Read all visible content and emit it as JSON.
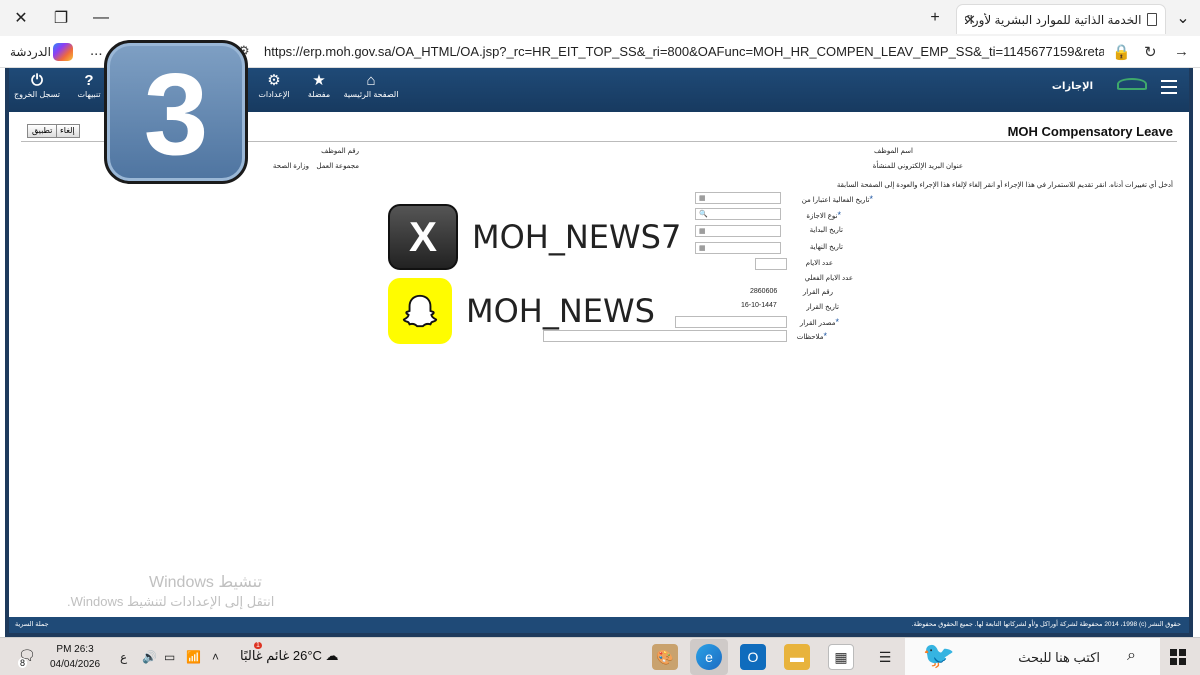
{
  "browser": {
    "tab_title": "الخدمة الذاتية للموارد البشرية لأوراكل",
    "url": "https://erp.moh.gov.sa/OA_HTML/OA.jsp?_rc=HR_EIT_TOP_SS&_ri=800&OAFunc=MOH_HR_COMPEN_LEAV_EMP_SS&_ti=1145677159&retainAM=Y&add...",
    "chat_label": "الدردشة",
    "more_label": "...",
    "new_tab_label": "+"
  },
  "app_header": {
    "section_title": "الإجازات",
    "nav": [
      {
        "label": "تسجل الخروج",
        "icon": "power-icon"
      },
      {
        "label": "تنبيهات",
        "icon": "help-icon"
      },
      {
        "label": "الإعدادات",
        "icon": "gear-icon"
      },
      {
        "label": "مفضلة",
        "icon": "star-icon"
      },
      {
        "label": "الصفحة الرئيسية",
        "icon": "home-icon"
      }
    ]
  },
  "page": {
    "title": "MOH Compensatory Leave",
    "cancel_label": "إلغاء",
    "apply_label": "تطبيق",
    "employee_name_label": "اسم الموظف",
    "employee_number_label": "رقم الموظف",
    "org_email_label": "عنوان البريد الإلكتروني للمنشأة",
    "work_group_label": "مجموعة العمل",
    "work_group_value": "وزارة الصحة",
    "instructions": "أدخل أي تغييرات أدناه. انقر تقديم للاستمرار في هذا الإجراء أو انقر إلغاء لإلغاء هذا الإجراء والعودة إلى الصفحة السابقة",
    "fields": {
      "effective_date_label": "تاريخ الفعالية اعتبارا من",
      "leave_type_label": "نوع الاجازة",
      "start_date_label": "تاريخ البداية",
      "end_date_label": "تاريخ النهاية",
      "days_count_label": "عدد الايام",
      "actual_days_label": "عدد الايام الفعلي",
      "decision_number_label": "رقم القرار",
      "decision_number_value": "2860606",
      "decision_date_label": "تاريخ القرار",
      "decision_date_value": "16-10-1447",
      "decision_source_label": "مصدر القرار",
      "notes_label": "ملاحظات"
    }
  },
  "footer": {
    "copyright": "حقوق النشر (c) 2014 ،1998 محفوظة لشركة أوراكل و/أو لشركاتها التابعة لها. جميع الحقوق محفوظة.",
    "privacy_label": "جملة السرية"
  },
  "windows_activation": {
    "title": "تنشيط Windows",
    "subtitle": "انتقل إلى الإعدادات لتنشيط Windows."
  },
  "overlays": {
    "badge_number": "3",
    "x_handle": "MOH_NEWS7",
    "snapchat_handle": "MOH_NEWS"
  },
  "taskbar": {
    "search_text": "اكتب هنا للبحث",
    "weather_temp": "26°C",
    "weather_text": "غائم غالبًا",
    "weather_alert": "1",
    "time": "PM 26:3",
    "date": "04/04/2026",
    "lang": "ع",
    "notif_count": "8"
  },
  "colors": {
    "header_blue": "#1f4a77",
    "taskbar": "#e6e1df",
    "badge_blue": "#5b80aa",
    "snapchat_yellow": "#fffc00"
  }
}
